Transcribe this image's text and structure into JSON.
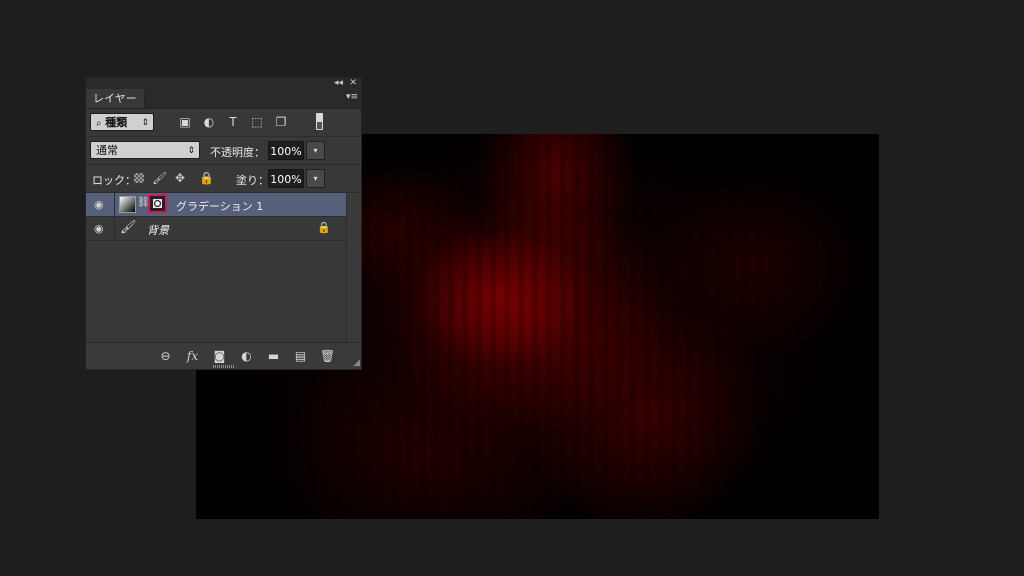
{
  "panel": {
    "collapse_icon": "double-chevron-left",
    "close_icon": "close-x",
    "tab_label": "レイヤー",
    "menu_icon": "panel-menu",
    "filter": {
      "kind_label": "種類",
      "icons": [
        "image-filter-icon",
        "adjustment-filter-icon",
        "type-filter-icon",
        "shape-filter-icon",
        "smart-object-filter-icon"
      ]
    },
    "blend": {
      "mode": "通常",
      "opacity_label": "不透明度：",
      "opacity_value": "100%"
    },
    "lock": {
      "label": "ロック：",
      "fill_label": "塗り：",
      "fill_value": "100%"
    },
    "layers": [
      {
        "name": "グラデーション 1",
        "selected": true,
        "type": "gradient-fill"
      },
      {
        "name": "背景",
        "selected": false,
        "type": "background",
        "locked": true
      }
    ],
    "footer_icons": [
      "link-layers",
      "fx",
      "add-mask",
      "adjustment-layer",
      "new-group",
      "new-layer",
      "delete"
    ]
  },
  "colors": {
    "panel_bg": "#383838",
    "selected_layer": "#57607a",
    "mask_highlight": "#d11a5b",
    "canvas_red": "#7a0000"
  }
}
